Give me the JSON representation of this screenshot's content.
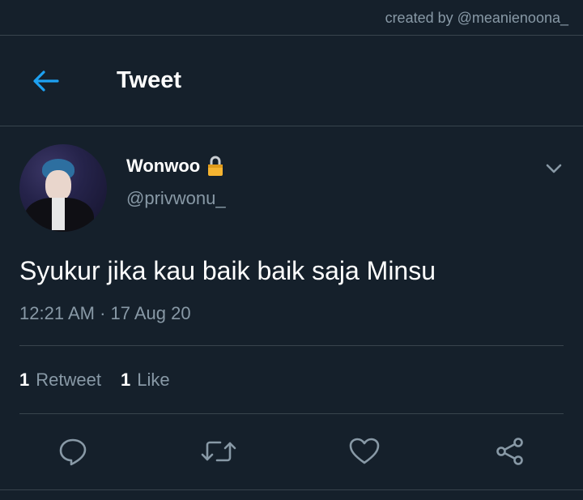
{
  "credit": "created by @meanienoona_",
  "header": {
    "title": "Tweet"
  },
  "tweet": {
    "display_name": "Wonwoo",
    "handle": "@privwonu_",
    "text": "Syukur jika kau baik baik saja Minsu",
    "timestamp": "12:21 AM · 17 Aug 20"
  },
  "stats": {
    "retweets": {
      "count": "1",
      "label": "Retweet"
    },
    "likes": {
      "count": "1",
      "label": "Like"
    }
  },
  "colors": {
    "background": "#15202b",
    "accent": "#1da1f2",
    "muted": "#8899a6",
    "lock": "#f5b431"
  },
  "icons": [
    "back-arrow-icon",
    "lock-icon",
    "chevron-down-icon",
    "reply-icon",
    "retweet-icon",
    "like-icon",
    "share-icon"
  ]
}
